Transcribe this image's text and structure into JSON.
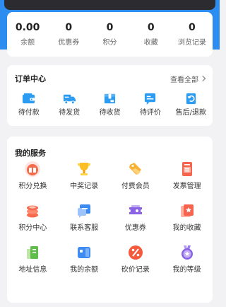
{
  "stats": [
    {
      "value": "0.00",
      "label": "余额"
    },
    {
      "value": "0",
      "label": "优惠券"
    },
    {
      "value": "0",
      "label": "积分"
    },
    {
      "value": "0",
      "label": "收藏"
    },
    {
      "value": "0",
      "label": "浏览记录"
    }
  ],
  "orders": {
    "title": "订单中心",
    "more": "查看全部",
    "items": [
      {
        "label": "待付款",
        "icon": "wallet-icon"
      },
      {
        "label": "待发货",
        "icon": "truck-icon"
      },
      {
        "label": "待收货",
        "icon": "package-icon"
      },
      {
        "label": "待评价",
        "icon": "comment-icon"
      },
      {
        "label": "售后/退款",
        "icon": "refund-icon"
      }
    ]
  },
  "services": {
    "title": "我的服务",
    "items": [
      {
        "label": "积分兑换",
        "icon": "points-exchange-icon"
      },
      {
        "label": "中奖记录",
        "icon": "trophy-icon"
      },
      {
        "label": "付费会员",
        "icon": "member-tag-icon"
      },
      {
        "label": "发票管理",
        "icon": "invoice-icon"
      },
      {
        "label": "积分中心",
        "icon": "coins-stack-icon"
      },
      {
        "label": "联系客服",
        "icon": "chat-service-icon"
      },
      {
        "label": "优惠券",
        "icon": "coupon-icon"
      },
      {
        "label": "我的收藏",
        "icon": "favorites-icon"
      },
      {
        "label": "地址信息",
        "icon": "address-book-icon"
      },
      {
        "label": "我的余额",
        "icon": "balance-card-icon"
      },
      {
        "label": "砍价记录",
        "icon": "bargain-icon"
      },
      {
        "label": "我的等级",
        "icon": "level-medal-icon"
      }
    ]
  },
  "colors": {
    "accent": "#2d8cf0",
    "order_icon": "#2c9cf2"
  }
}
